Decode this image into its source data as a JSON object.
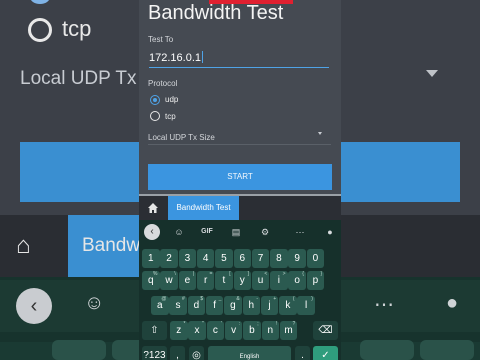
{
  "app": {
    "title": "Bandwidth Test",
    "test_to_label": "Test To",
    "ip_value": "172.16.0.1",
    "protocol_label": "Protocol",
    "protocol_options": [
      "udp",
      "tcp"
    ],
    "protocol_selected": "udp",
    "tx_size_label": "Local UDP Tx Size",
    "start_label": "START"
  },
  "nav": {
    "tab_label": "Bandwidth Test"
  },
  "background": {
    "radio_text": "tcp",
    "local_text": "Local UDP Tx",
    "tab_text": "Bandw"
  },
  "keyboard": {
    "toolbar": [
      "sticker",
      "GIF",
      "clipboard",
      "settings",
      "more",
      "mic"
    ],
    "gif_label": "GIF",
    "row_numbers": [
      "1",
      "2",
      "3",
      "4",
      "5",
      "6",
      "7",
      "8",
      "9",
      "0"
    ],
    "row_q": [
      {
        "k": "q",
        "s": "%"
      },
      {
        "k": "w",
        "s": "\\"
      },
      {
        "k": "e",
        "s": "|"
      },
      {
        "k": "r",
        "s": "="
      },
      {
        "k": "t",
        "s": "["
      },
      {
        "k": "y",
        "s": "]"
      },
      {
        "k": "u",
        "s": "<"
      },
      {
        "k": "i",
        "s": ">"
      },
      {
        "k": "o",
        "s": "{"
      },
      {
        "k": "p",
        "s": "}"
      }
    ],
    "row_a": [
      {
        "k": "a",
        "s": "@"
      },
      {
        "k": "s",
        "s": "#"
      },
      {
        "k": "d",
        "s": "$"
      },
      {
        "k": "f",
        "s": "_"
      },
      {
        "k": "g",
        "s": "&"
      },
      {
        "k": "h",
        "s": "-"
      },
      {
        "k": "j",
        "s": "+"
      },
      {
        "k": "k",
        "s": "("
      },
      {
        "k": "l",
        "s": ")"
      }
    ],
    "row_z": [
      {
        "k": "z",
        "s": "*"
      },
      {
        "k": "x",
        "s": "\""
      },
      {
        "k": "c",
        "s": "'"
      },
      {
        "k": "v",
        "s": ":"
      },
      {
        "k": "b",
        "s": ";"
      },
      {
        "k": "n",
        "s": "!"
      },
      {
        "k": "m",
        "s": "?"
      }
    ],
    "symbols_label": "?123",
    "comma_label": ",",
    "space_label": "English",
    "period_label": "."
  },
  "colors": {
    "accent": "#3b95e0",
    "panel": "#454a52",
    "keyboard_bg": "#16302b",
    "key": "#2b5a50",
    "enter_key": "#2f9d7d",
    "alert": "#e02030"
  }
}
